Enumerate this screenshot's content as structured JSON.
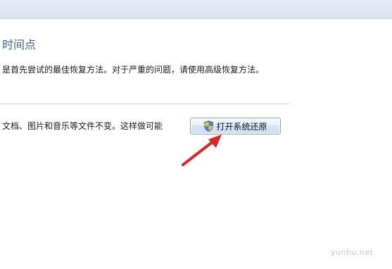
{
  "section": {
    "title": "时间点"
  },
  "description": {
    "text": "是首先尝试的最佳恢复方法。对于严重的问题，请使用高级恢复方法。"
  },
  "restore": {
    "text": "文档、图片和音乐等文件不变。这样做可能",
    "button_label": "打开系统还原",
    "button_icon": "uac-shield-icon"
  },
  "watermark": {
    "text": "yunhu.net"
  },
  "colors": {
    "title_blue": "#2f64b7",
    "arrow_red": "#e02424",
    "divider": "#d6d6d6"
  }
}
